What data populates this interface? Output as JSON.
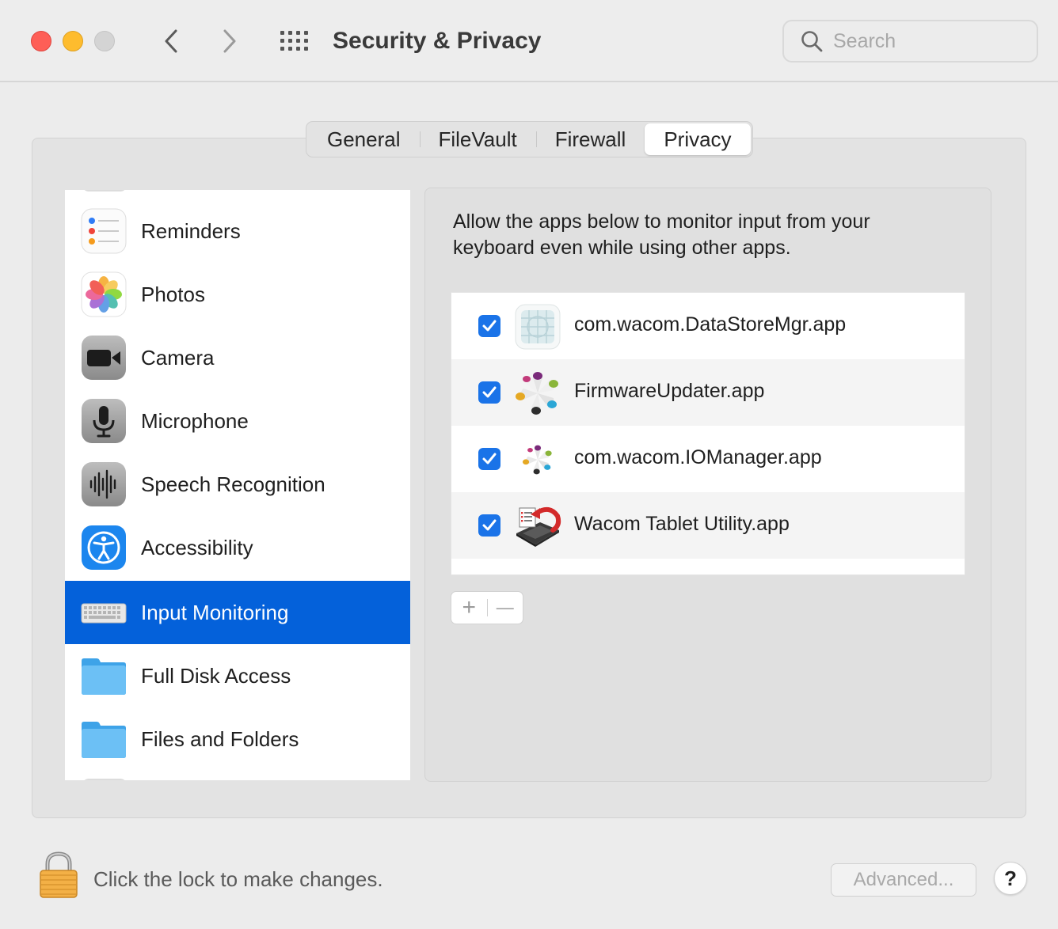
{
  "window": {
    "title": "Security & Privacy"
  },
  "search": {
    "placeholder": "Search",
    "value": ""
  },
  "tabs": [
    {
      "label": "General",
      "active": false
    },
    {
      "label": "FileVault",
      "active": false
    },
    {
      "label": "Firewall",
      "active": false
    },
    {
      "label": "Privacy",
      "active": true
    }
  ],
  "sidebar": {
    "items": [
      {
        "label": "Reminders",
        "icon": "reminders-icon",
        "selected": false
      },
      {
        "label": "Photos",
        "icon": "photos-icon",
        "selected": false
      },
      {
        "label": "Camera",
        "icon": "camera-icon",
        "selected": false
      },
      {
        "label": "Microphone",
        "icon": "microphone-icon",
        "selected": false
      },
      {
        "label": "Speech Recognition",
        "icon": "waveform-icon",
        "selected": false
      },
      {
        "label": "Accessibility",
        "icon": "accessibility-icon",
        "selected": false
      },
      {
        "label": "Input Monitoring",
        "icon": "keyboard-icon",
        "selected": true
      },
      {
        "label": "Full Disk Access",
        "icon": "folder-icon",
        "selected": false
      },
      {
        "label": "Files and Folders",
        "icon": "folder-icon",
        "selected": false
      }
    ]
  },
  "content": {
    "description": "Allow the apps below to monitor input from your keyboard even while using other apps.",
    "apps": [
      {
        "name": "com.wacom.DataStoreMgr.app",
        "checked": true,
        "icon": "grid-app-icon"
      },
      {
        "name": "FirmwareUpdater.app",
        "checked": true,
        "icon": "wacom-pinwheel-icon"
      },
      {
        "name": "com.wacom.IOManager.app",
        "checked": true,
        "icon": "wacom-pinwheel-small-icon"
      },
      {
        "name": "Wacom Tablet Utility.app",
        "checked": true,
        "icon": "tablet-utility-icon"
      }
    ],
    "add_label": "+",
    "remove_label": "—"
  },
  "footer": {
    "lock_text": "Click the lock to make changes.",
    "advanced_label": "Advanced...",
    "help_label": "?"
  },
  "colors": {
    "accent": "#0461da",
    "checkbox": "#1a73e8",
    "close": "#fe5f57",
    "minimize": "#febc2e"
  }
}
